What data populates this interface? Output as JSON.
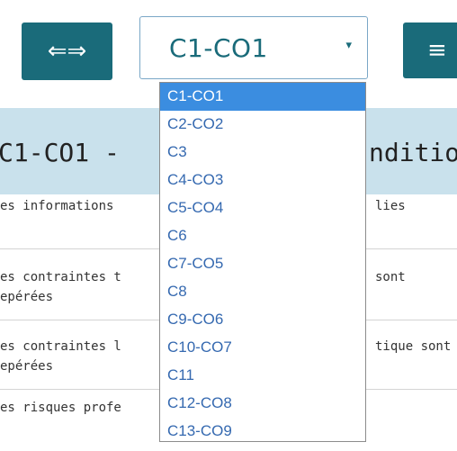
{
  "toolbar": {
    "swap_icon": "⇐⇒",
    "menu_icon": "≡"
  },
  "select": {
    "value": "C1-CO1",
    "caret": "▾",
    "options": [
      "C1-CO1",
      "C2-CO2",
      "C3",
      "C4-CO3",
      "C5-CO4",
      "C6",
      "C7-CO5",
      "C8",
      "C9-CO6",
      "C10-CO7",
      "C11",
      "C12-CO8",
      "C13-CO9"
    ]
  },
  "header": {
    "title_left": "C1-CO1 -",
    "title_right": "ndition"
  },
  "rows": [
    {
      "left": [
        "es informations"
      ],
      "right": [
        "lies"
      ]
    },
    {
      "left": [
        "es contraintes t",
        "epérées"
      ],
      "right": [
        "sont"
      ]
    },
    {
      "left": [
        "es contraintes l",
        "epérées"
      ],
      "right": [
        "tique sont"
      ]
    },
    {
      "left": [
        "es risques profe"
      ],
      "right": []
    }
  ]
}
